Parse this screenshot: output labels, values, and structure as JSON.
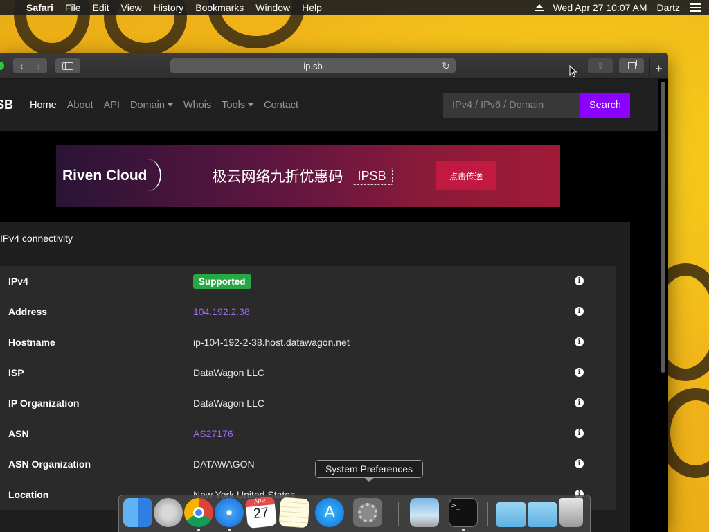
{
  "menubar": {
    "app_name": "Safari",
    "items": [
      "File",
      "Edit",
      "View",
      "History",
      "Bookmarks",
      "Window",
      "Help"
    ],
    "datetime": "Wed Apr 27  10:07 AM",
    "user": "Dartz"
  },
  "browser": {
    "url": "ip.sb",
    "new_tab_label": "+"
  },
  "site_nav": {
    "brand": "SB",
    "links": [
      "Home",
      "About",
      "API",
      "Domain",
      "Whois",
      "Tools",
      "Contact"
    ],
    "search_placeholder": "IPv4 / IPv6 / Domain",
    "search_button": "Search"
  },
  "banner": {
    "logo": "Riven Cloud",
    "text": "极云网络九折优惠码",
    "code": "IPSB",
    "button": "点击传送"
  },
  "card": {
    "title": "IPv4 connectivity",
    "rows": [
      {
        "label": "IPv4",
        "value": "Supported",
        "type": "badge"
      },
      {
        "label": "Address",
        "value": "104.192.2.38",
        "type": "link"
      },
      {
        "label": "Hostname",
        "value": "ip-104-192-2-38.host.datawagon.net",
        "type": "text"
      },
      {
        "label": "ISP",
        "value": "DataWagon LLC",
        "type": "text"
      },
      {
        "label": "IP Organization",
        "value": "DataWagon LLC",
        "type": "text"
      },
      {
        "label": "ASN",
        "value": "AS27176",
        "type": "link"
      },
      {
        "label": "ASN Organization",
        "value": "DATAWAGON",
        "type": "text"
      },
      {
        "label": "Location",
        "value": "New York United States",
        "type": "text"
      }
    ]
  },
  "tooltip": "System Preferences",
  "colors": {
    "accent": "#8b00ff",
    "supported": "#28a745",
    "link": "#9b6cf0"
  },
  "dock": {
    "apps": [
      "finder-icon",
      "launchpad-icon",
      "chrome-icon",
      "safari-icon",
      "calendar-icon",
      "notes-icon",
      "app-store-icon",
      "system-preferences-icon",
      "preview-icon",
      "terminal-icon",
      "applications-folder-icon",
      "downloads-folder-icon",
      "trash-icon"
    ],
    "calendar_month": "APR",
    "calendar_day": "27",
    "terminal_prompt": ">_"
  }
}
